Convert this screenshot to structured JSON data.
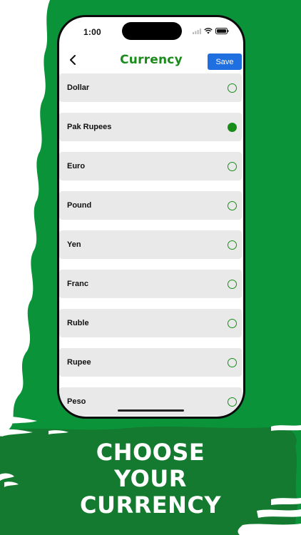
{
  "status_bar": {
    "time": "1:00"
  },
  "header": {
    "title": "Currency",
    "save_label": "Save"
  },
  "currencies": [
    {
      "label": "Dollar",
      "selected": false
    },
    {
      "label": "Pak Rupees",
      "selected": true
    },
    {
      "label": "Euro",
      "selected": false
    },
    {
      "label": "Pound",
      "selected": false
    },
    {
      "label": "Yen",
      "selected": false
    },
    {
      "label": "Franc",
      "selected": false
    },
    {
      "label": "Ruble",
      "selected": false
    },
    {
      "label": "Rupee",
      "selected": false
    },
    {
      "label": "Peso",
      "selected": false
    }
  ],
  "banner": {
    "line1": "CHOOSE",
    "line2": "YOUR",
    "line3": "CURRENCY"
  },
  "colors": {
    "brand_green": "#1a8c1a",
    "background_green": "#0a9338",
    "banner_dark_green": "#137a2f",
    "save_blue": "#1f6fe0",
    "row_gray": "#e9e9e9"
  },
  "icons": {
    "back": "chevron-left-icon",
    "wifi": "wifi-icon",
    "battery": "battery-icon"
  }
}
